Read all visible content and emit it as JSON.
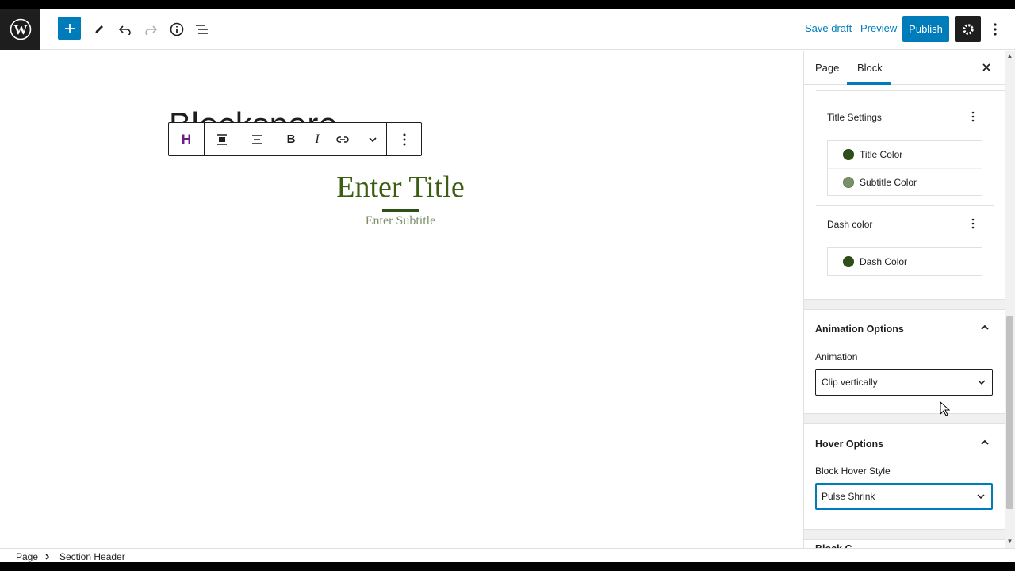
{
  "topbar": {
    "save_draft": "Save draft",
    "preview": "Preview",
    "publish": "Publish",
    "icons": [
      "wordpress-logo",
      "plus-icon",
      "pencil-icon",
      "undo-icon",
      "redo-icon",
      "info-icon",
      "list-view-icon",
      "gear-icon",
      "more-vertical-icon"
    ]
  },
  "canvas": {
    "ghost_title": "Blockspare",
    "heading_title": "Enter Title",
    "heading_subtitle": "Enter Subtitle",
    "toolbar_icons": [
      "heading-block-icon",
      "align-center-block-icon",
      "text-align-icon",
      "bold-icon",
      "italic-icon",
      "link-icon",
      "chevron-down-icon",
      "more-vertical-icon"
    ],
    "toolbar_heading_glyph": "H",
    "toolbar_bold_glyph": "B",
    "toolbar_italic_glyph": "I"
  },
  "sidebar": {
    "tabs": [
      {
        "label": "Page"
      },
      {
        "label": "Block",
        "active": true
      }
    ],
    "title_settings": {
      "label": "Title Settings",
      "colors": [
        {
          "label": "Title Color",
          "swatch": "#2d5016"
        },
        {
          "label": "Subtitle Color",
          "swatch": "#7a9068"
        }
      ]
    },
    "dash_settings": {
      "label": "Dash color",
      "colors": [
        {
          "label": "Dash Color",
          "swatch": "#2d5016"
        }
      ]
    },
    "animation": {
      "title": "Animation Options",
      "field_label": "Animation",
      "value": "Clip vertically"
    },
    "hover": {
      "title": "Hover Options",
      "field_label": "Block Hover Style",
      "value": "Pulse Shrink"
    },
    "next_panel_partial": "Block C"
  },
  "footer": {
    "breadcrumb": [
      "Page",
      "Section Header"
    ]
  },
  "colors": {
    "accent": "#007cba",
    "title_green": "#3b5e12",
    "dark_green": "#2d5016",
    "subtitle_green": "#7a9068"
  }
}
